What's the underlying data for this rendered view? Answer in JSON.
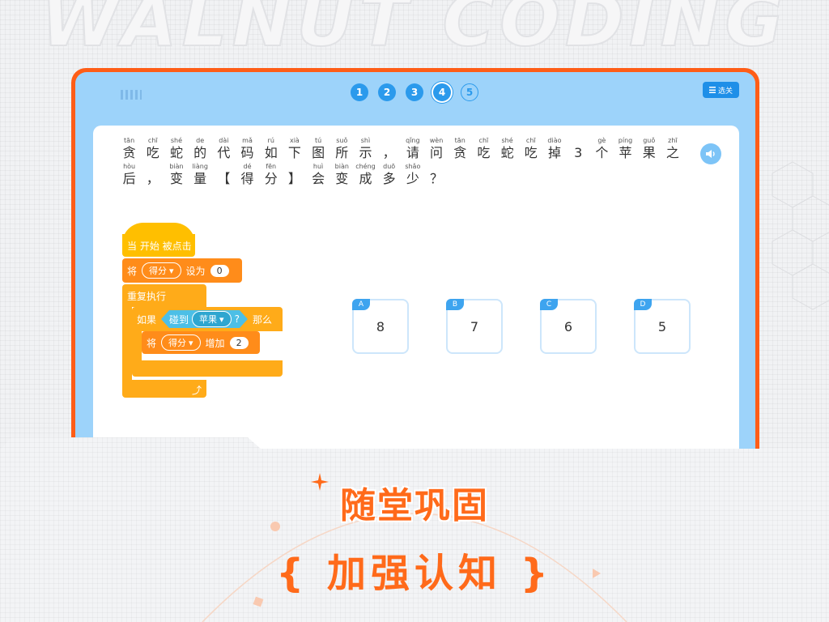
{
  "brand": {
    "watermark": "WALNUT CODING"
  },
  "top_bar": {
    "steps": [
      {
        "label": "1",
        "state": "done"
      },
      {
        "label": "2",
        "state": "done"
      },
      {
        "label": "3",
        "state": "done"
      },
      {
        "label": "4",
        "state": "current"
      },
      {
        "label": "5",
        "state": "pending"
      }
    ],
    "level_button": "选关"
  },
  "question": {
    "line1": [
      {
        "py": "tān",
        "hz": "贪"
      },
      {
        "py": "chī",
        "hz": "吃"
      },
      {
        "py": "shé",
        "hz": "蛇"
      },
      {
        "py": "de",
        "hz": "的"
      },
      {
        "py": "dài",
        "hz": "代"
      },
      {
        "py": "mǎ",
        "hz": "码"
      },
      {
        "py": "rú",
        "hz": "如"
      },
      {
        "py": "xià",
        "hz": "下"
      },
      {
        "py": "tú",
        "hz": "图"
      },
      {
        "py": "suǒ",
        "hz": "所"
      },
      {
        "py": "shì",
        "hz": "示"
      },
      {
        "py": "",
        "hz": "，"
      },
      {
        "py": "qǐng",
        "hz": "请"
      },
      {
        "py": "wèn",
        "hz": "问"
      },
      {
        "py": "tān",
        "hz": "贪"
      },
      {
        "py": "chī",
        "hz": "吃"
      },
      {
        "py": "shé",
        "hz": "蛇"
      },
      {
        "py": "chī",
        "hz": "吃"
      },
      {
        "py": "diào",
        "hz": "掉"
      },
      {
        "py": "",
        "hz": "3"
      },
      {
        "py": "gè",
        "hz": "个"
      },
      {
        "py": "píng",
        "hz": "苹"
      },
      {
        "py": "guǒ",
        "hz": "果"
      },
      {
        "py": "zhī",
        "hz": "之"
      }
    ],
    "line2": [
      {
        "py": "hòu",
        "hz": "后"
      },
      {
        "py": "",
        "hz": "，"
      },
      {
        "py": "biàn",
        "hz": "变"
      },
      {
        "py": "liàng",
        "hz": "量"
      },
      {
        "py": "",
        "hz": "【"
      },
      {
        "py": "dé",
        "hz": "得"
      },
      {
        "py": "fēn",
        "hz": "分"
      },
      {
        "py": "",
        "hz": "】"
      },
      {
        "py": "huì",
        "hz": "会"
      },
      {
        "py": "biàn",
        "hz": "变"
      },
      {
        "py": "chéng",
        "hz": "成"
      },
      {
        "py": "duō",
        "hz": "多"
      },
      {
        "py": "shǎo",
        "hz": "少"
      },
      {
        "py": "",
        "hz": "？"
      }
    ]
  },
  "code_blocks": {
    "event": "当 开始 被点击",
    "set": {
      "verb": "将",
      "var": "得分",
      "op": "设为",
      "value": "0"
    },
    "loop": "重复执行",
    "if": {
      "kw": "如果",
      "sense": "碰到",
      "target": "苹果",
      "q": "?",
      "then": "那么"
    },
    "change": {
      "verb": "将",
      "var": "得分",
      "op": "增加",
      "value": "2"
    }
  },
  "options": [
    {
      "letter": "A",
      "value": "8"
    },
    {
      "letter": "B",
      "value": "7"
    },
    {
      "letter": "C",
      "value": "6"
    },
    {
      "letter": "D",
      "value": "5"
    }
  ],
  "banner": {
    "title": "随堂巩固",
    "subtitle": "{ 加强认知 }"
  },
  "colors": {
    "frame": "#fe5d17",
    "screen": "#9dd3fa",
    "accent_blue": "#2b9aec",
    "event_block": "#ffbf00",
    "variable_block": "#ff8c1a",
    "control_block": "#ffab19",
    "sensing_block": "#4cbfe6",
    "banner_text": "#ff6a1a"
  }
}
